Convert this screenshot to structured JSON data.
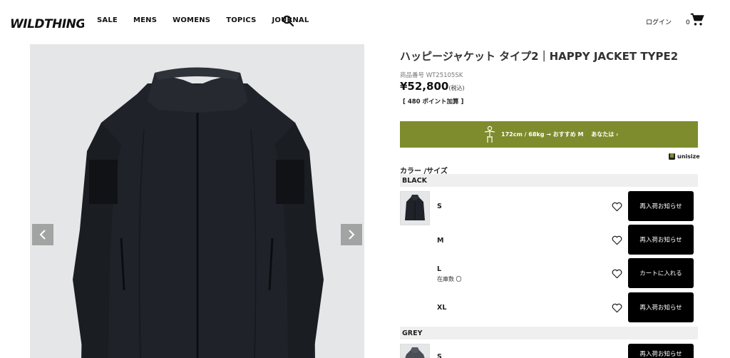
{
  "header": {
    "logo_text": "WILDTHINGS",
    "nav": [
      "SALE",
      "MENS",
      "WOMENS",
      "TOPICS",
      "JOURNAL"
    ],
    "login": "ログイン",
    "cart_count": "0"
  },
  "product": {
    "title": "ハッピージャケット タイプ2｜HAPPY JACKET TYPE2",
    "sku": "商品番号 WT25105SK",
    "price": "¥52,800",
    "price_tax": "(税込)",
    "points": "[ 480 ポイント加算 ]"
  },
  "unisize": {
    "text": "172cm / 68kg → おすすめ M　 あなたは ›",
    "logo": "unisize",
    "color": "#7e8c2d"
  },
  "color_size_label": "カラー /サイズ",
  "colors": [
    {
      "name": "BLACK",
      "sizes": [
        {
          "size": "S",
          "stock": "",
          "button": "再入荷お知らせ"
        },
        {
          "size": "M",
          "stock": "",
          "button": "再入荷お知らせ"
        },
        {
          "size": "L",
          "stock": "在庫数 〇",
          "button": "カートに入れる"
        },
        {
          "size": "XL",
          "stock": "",
          "button": "再入荷お知らせ"
        }
      ]
    },
    {
      "name": "GREY",
      "sizes": [
        {
          "size": "S",
          "stock": "",
          "button": "再入荷お知らせ"
        }
      ]
    }
  ],
  "icons": {
    "search": "search-icon",
    "cart": "cart-icon",
    "heart": "heart-icon",
    "prev": "chevron-left-icon",
    "next": "chevron-right-icon"
  }
}
